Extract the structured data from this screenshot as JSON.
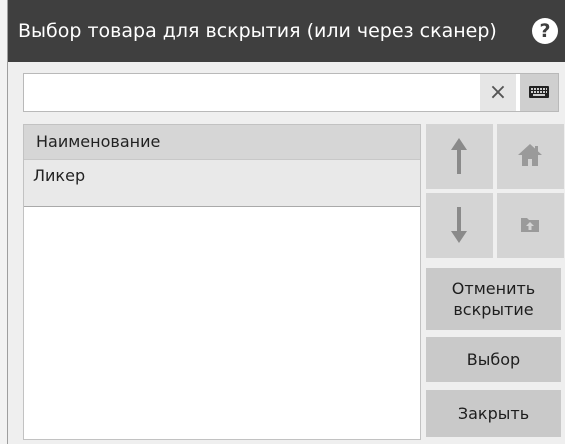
{
  "dialog": {
    "title": "Выбор товара для вскрытия (или через сканер)",
    "help_icon": "question-circle-icon"
  },
  "search": {
    "value": "",
    "placeholder": "",
    "clear_label": "×",
    "keyboard_icon": "keyboard-icon"
  },
  "list": {
    "header": "Наименование",
    "items": [
      {
        "label": "Ликер"
      }
    ]
  },
  "nav": {
    "up_icon": "arrow-up-icon",
    "home_icon": "home-icon",
    "down_icon": "arrow-down-icon",
    "folder_up_icon": "folder-up-icon"
  },
  "buttons": {
    "cancel_opening_line1": "Отменить",
    "cancel_opening_line2": "вскрытие",
    "select": "Выбор",
    "close": "Закрыть"
  },
  "colors": {
    "titlebar": "#3f3f3f",
    "button": "#c9c9c9",
    "nav_button": "#d4d4d4",
    "selected_row": "#e9e9e9"
  }
}
